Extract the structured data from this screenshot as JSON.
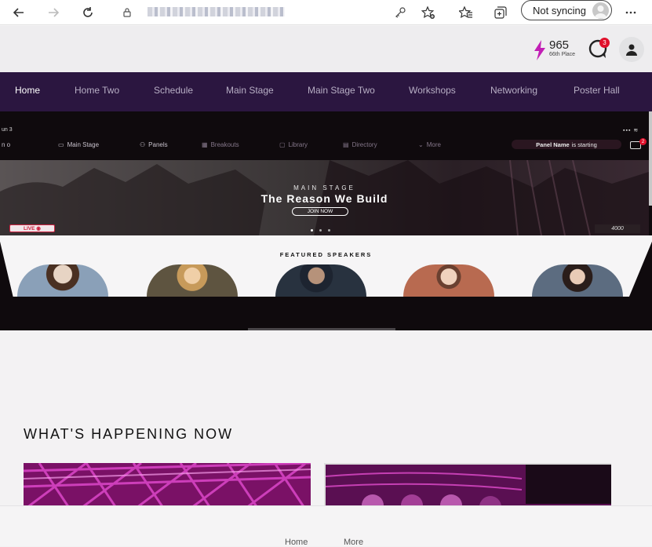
{
  "browser": {
    "sync_label": "Not syncing",
    "icons": [
      "back-arrow-icon",
      "forward-arrow-icon",
      "refresh-icon",
      "lock-icon",
      "key-icon",
      "add-favorite-icon",
      "favorites-icon",
      "collections-icon",
      "more-icon"
    ]
  },
  "header": {
    "points": "965",
    "rank": "66th Place",
    "notifications": "3"
  },
  "nav": {
    "items": [
      "Home",
      "Home Two",
      "Schedule",
      "Main Stage",
      "Main Stage Two",
      "Workshops",
      "Networking",
      "Poster Hall"
    ],
    "active": "Home"
  },
  "preview": {
    "status_left": "un 3",
    "status_left2": "n o",
    "inner_nav": [
      "Main Stage",
      "Panels",
      "Breakouts",
      "Library",
      "Directory",
      "More"
    ],
    "panel_alert_name": "Panel Name",
    "panel_alert_suffix": "is starting",
    "alert_badge": "2",
    "banner_eyebrow": "MAIN STAGE",
    "banner_title": "The Reason We Build",
    "banner_cta": "JOIN NOW",
    "live_label": "LIVE",
    "viewer_count": "4000",
    "speakers_heading": "FEATURED SPEAKERS"
  },
  "section": {
    "title": "WHAT'S HAPPENING NOW"
  },
  "bottom_nav": [
    "Home",
    "More"
  ],
  "colors": {
    "nav_bg": "#2b1640",
    "accent": "#c21fb5",
    "badge": "#e0102b"
  }
}
